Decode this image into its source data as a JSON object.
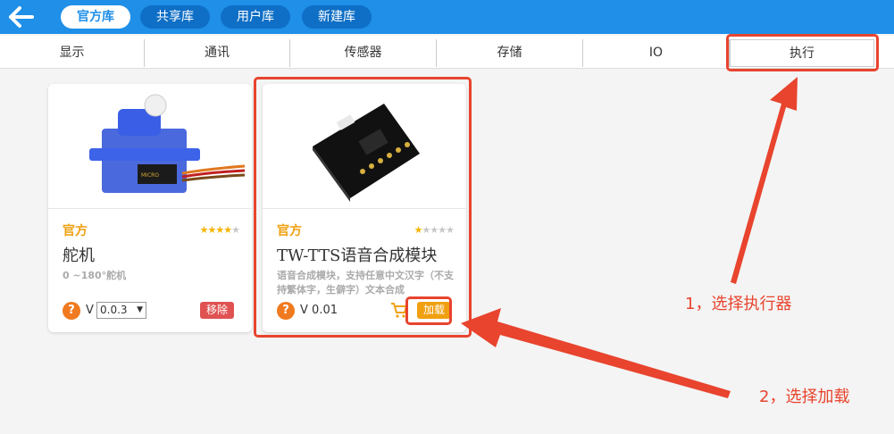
{
  "header": {
    "back_icon": "arrow-left-icon",
    "tabs": [
      {
        "label": "官方库",
        "active": true
      },
      {
        "label": "共享库",
        "active": false
      },
      {
        "label": "用户库",
        "active": false
      },
      {
        "label": "新建库",
        "active": false
      }
    ]
  },
  "categories": [
    "显示",
    "通讯",
    "传感器",
    "存储",
    "IO",
    "执行"
  ],
  "selected_category": "执行",
  "cards": [
    {
      "badge": "官方",
      "rating": 4,
      "name": "舵机",
      "desc": "0 ~180°舵机",
      "version_prefix": "V",
      "version": "0.0.3",
      "action": "移除"
    },
    {
      "badge": "官方",
      "rating": 1,
      "name": "TW-TTS语音合成模块",
      "desc": "语音合成模块，支持任意中文汉字（不支持繁体字，生僻字）文本合成",
      "version_prefix": "V",
      "version": "0.01",
      "action": "加载"
    }
  ],
  "annotations": {
    "step1": "1，选择执行器",
    "step2": "2，选择加载"
  },
  "colors": {
    "header_blue": "#1f8fe8",
    "annotation_red": "#e8442e",
    "official_orange": "#f0a010",
    "remove_red": "#e05252"
  }
}
